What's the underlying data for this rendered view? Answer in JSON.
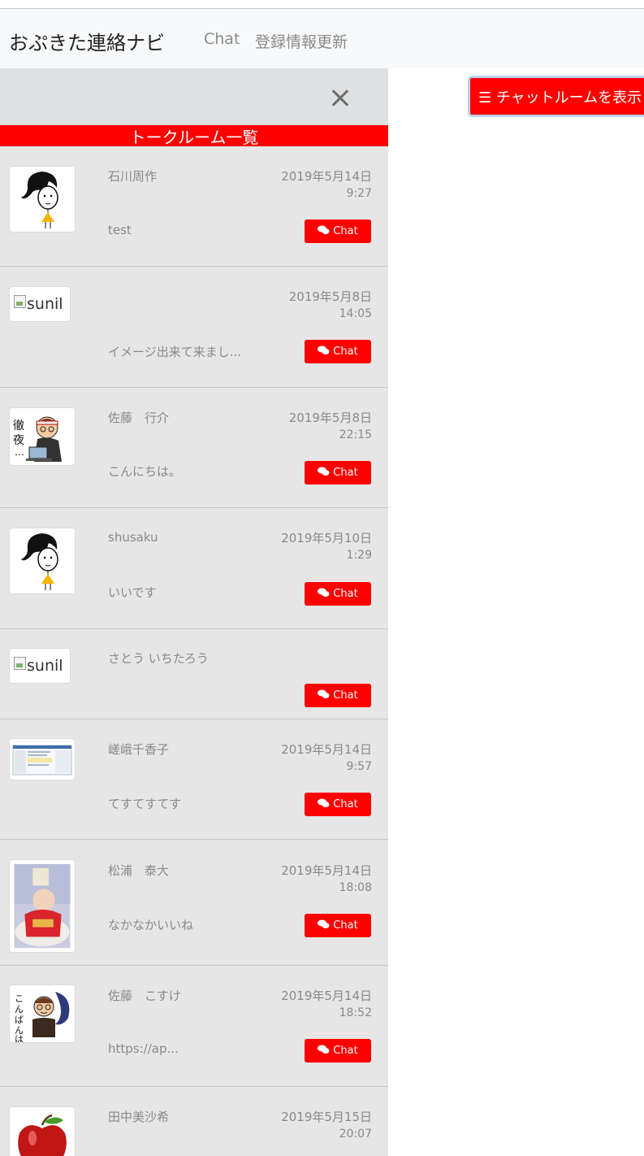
{
  "navbar": {
    "brand": "おぷきた連絡ナビ",
    "links": [
      "Chat",
      "登録情報更新"
    ]
  },
  "sidebar": {
    "title": "トークルーム一覧",
    "chat_label": "Chat",
    "rooms": [
      {
        "name": "石川周作",
        "date": "2019年5月14日",
        "time": "9:27",
        "message": "test",
        "avatar": "woman-cartoon"
      },
      {
        "name": "",
        "date": "2019年5月8日",
        "time": "14:05",
        "message": "イメージ出来て来まし...",
        "avatar": "broken-image",
        "avatar_alt": "sunil"
      },
      {
        "name": "佐藤　行介",
        "date": "2019年5月8日",
        "time": "22:15",
        "message": "こんにちは。",
        "avatar": "man-laptop-cartoon"
      },
      {
        "name": "shusaku",
        "date": "2019年5月10日",
        "time": "1:29",
        "message": "いいです",
        "avatar": "woman-cartoon"
      },
      {
        "name": "さとう いちたろう",
        "date": "",
        "time": "",
        "message": "",
        "avatar": "broken-image",
        "avatar_alt": "sunil"
      },
      {
        "name": "嵯峨千香子",
        "date": "2019年5月14日",
        "time": "9:57",
        "message": "てすてすてす",
        "avatar": "screenshot-thumbnail"
      },
      {
        "name": "松浦　泰大",
        "date": "2019年5月14日",
        "time": "18:08",
        "message": "なかなかいいね",
        "avatar": "baby-photo"
      },
      {
        "name": "佐藤　こすけ",
        "date": "2019年5月14日",
        "time": "18:52",
        "message": "https://ap...",
        "avatar": "goodnight-cartoon"
      },
      {
        "name": "田中美沙希",
        "date": "2019年5月15日",
        "time": "20:07",
        "message": "",
        "avatar": "apple"
      }
    ]
  },
  "main": {
    "show_rooms_label": "☰ チャットルームを表示"
  },
  "colors": {
    "accent": "#ff0000",
    "sidebar_bg": "#e6e6e6",
    "navbar_bg": "#f8f9fa",
    "muted_text": "#8a8a8a"
  }
}
